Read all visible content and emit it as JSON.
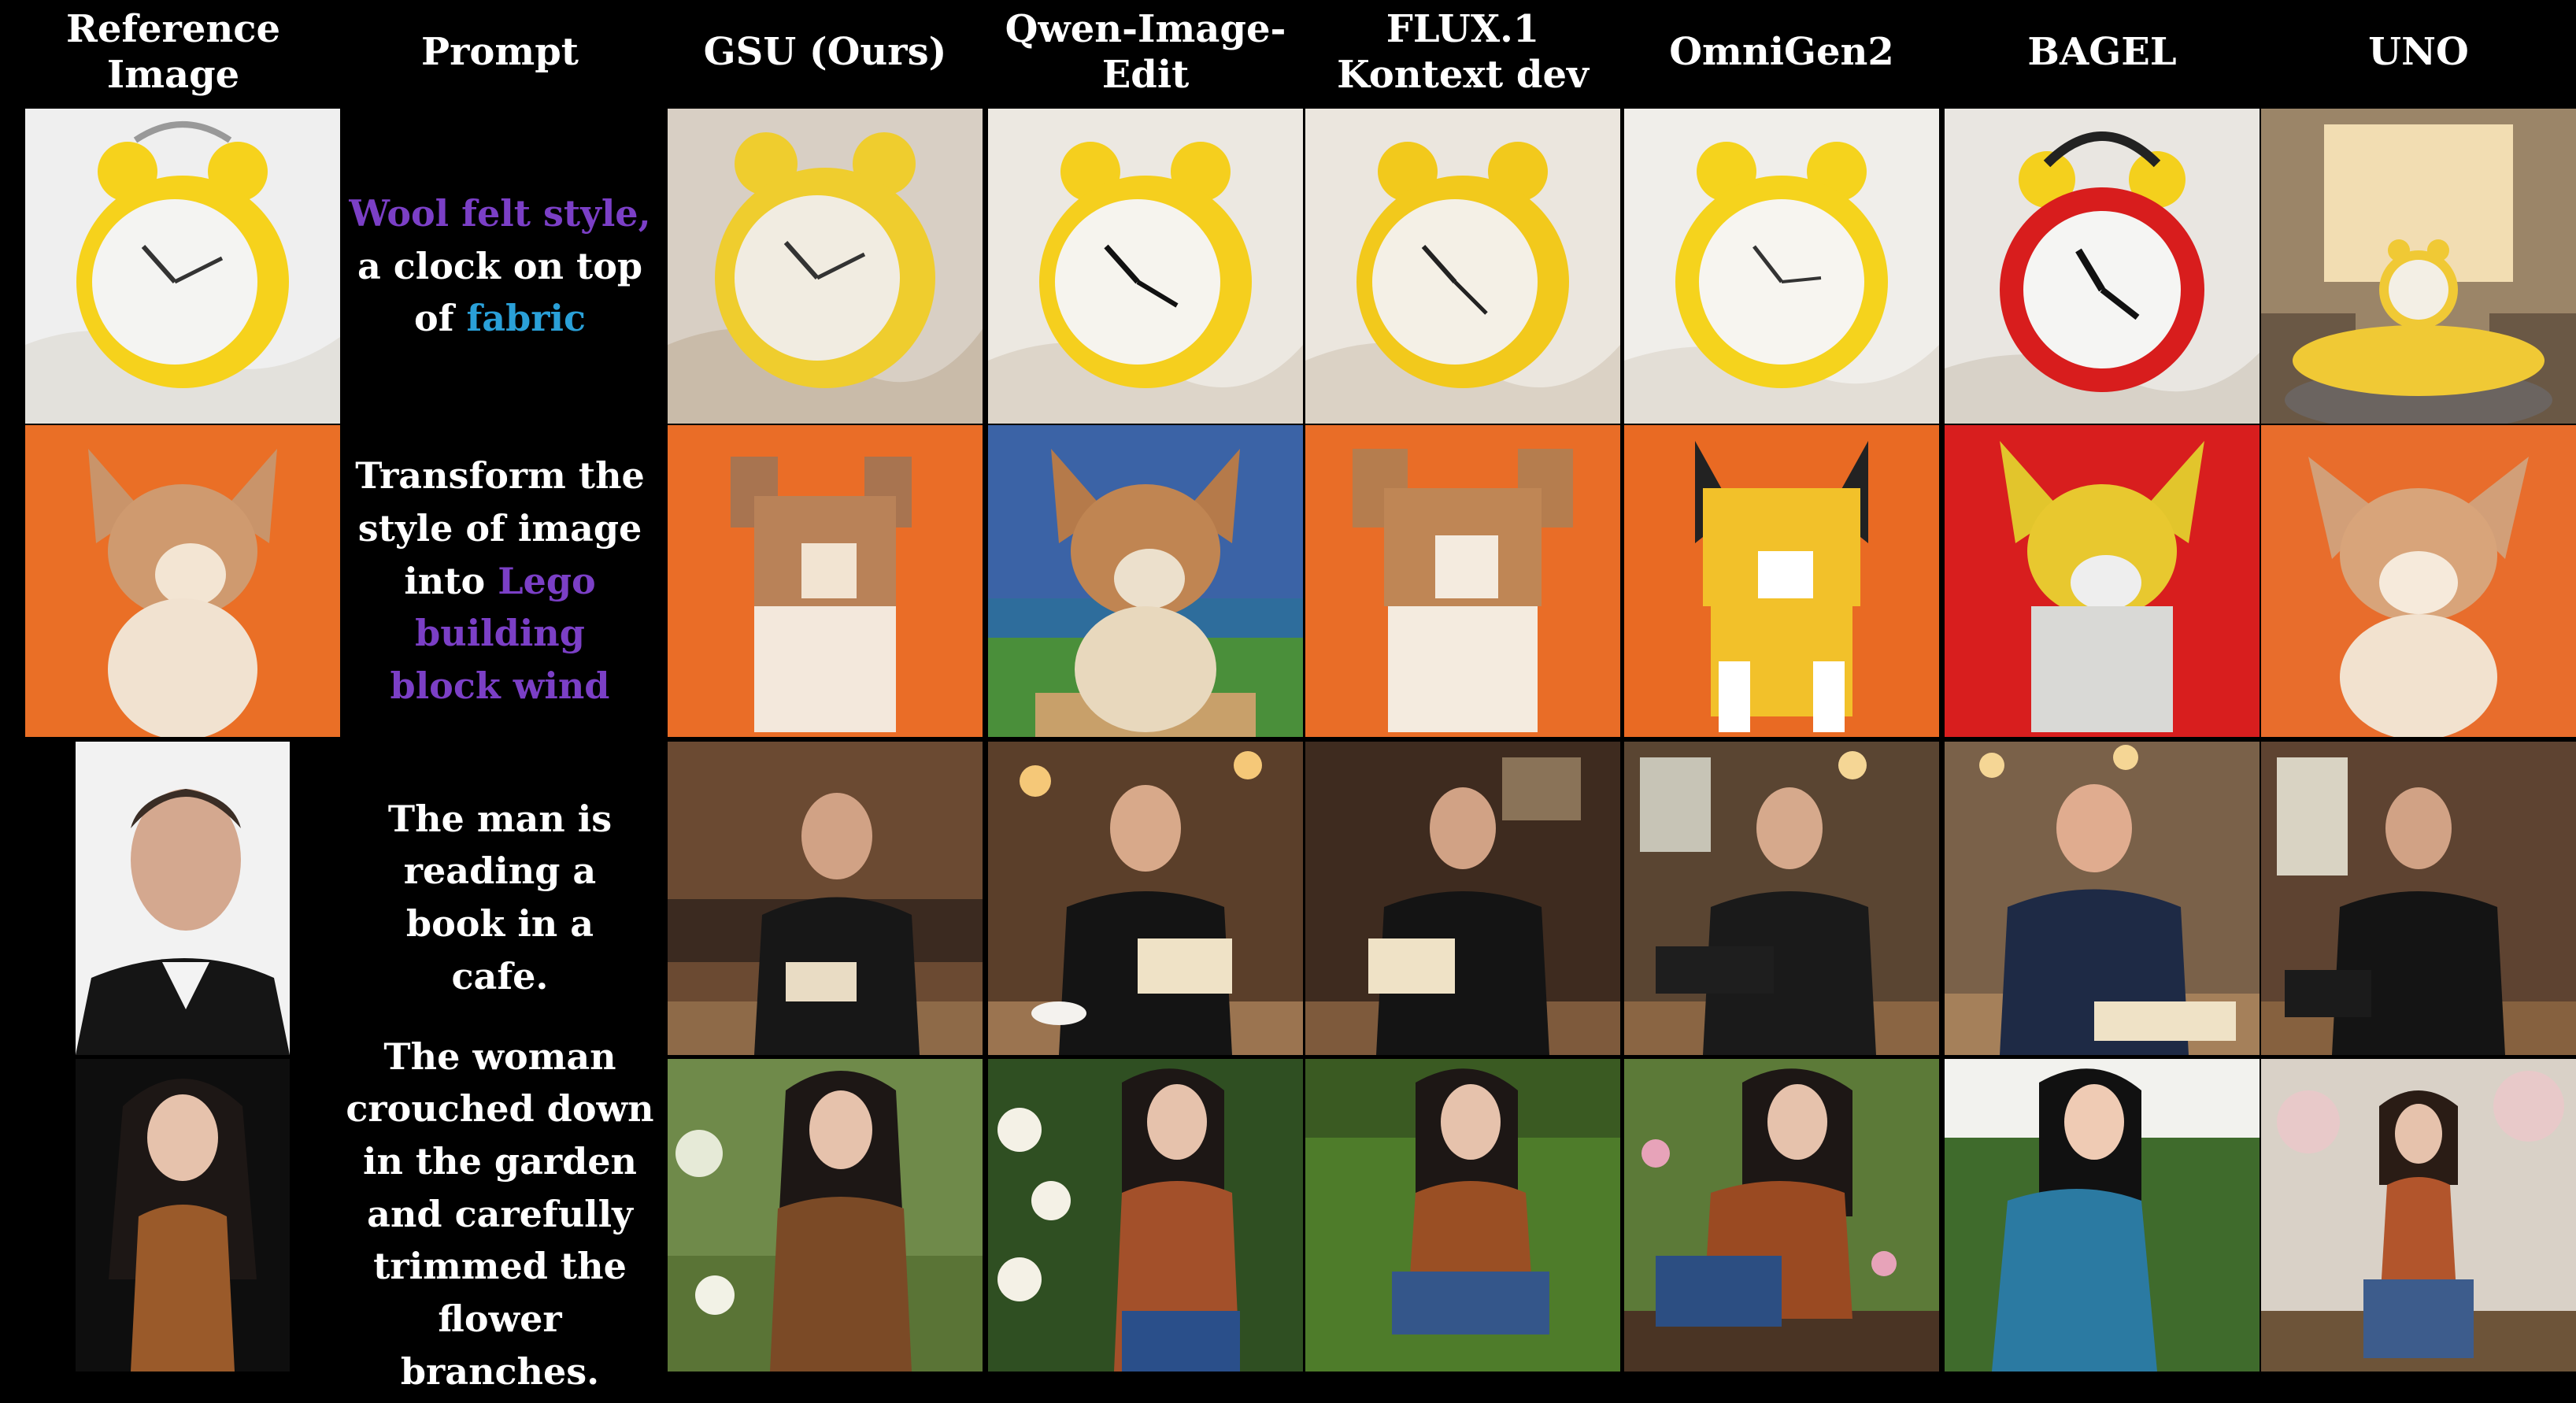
{
  "headers": {
    "reference": "Reference Image",
    "prompt": "Prompt",
    "col1": "GSU (Ours)",
    "col2": "Qwen-Image-Edit",
    "col3": "FLUX.1 Kontext dev",
    "col4": "OmniGen2",
    "col5": "BAGEL",
    "col6": "UNO"
  },
  "prompts": {
    "row1": {
      "p1": "Wool felt style,",
      "p2": "a clock on top",
      "p3": "of ",
      "p4": "fabric"
    },
    "row2": {
      "p1": "Transform the",
      "p2": "style of image",
      "p3": "into ",
      "p4": "Lego building",
      "p5": "block wind"
    },
    "row3": {
      "p1": "The man is",
      "p2": "reading a",
      "p3": "book in a",
      "p4": "cafe."
    },
    "row4": {
      "p1": "The woman",
      "p2": "crouched down",
      "p3": "in the garden",
      "p4": "and carefully",
      "p5": "trimmed the",
      "p6": "flower branches."
    }
  },
  "colors": {
    "purple": "#7b3fc6",
    "blue": "#2aa0d8",
    "background": "#000000"
  }
}
